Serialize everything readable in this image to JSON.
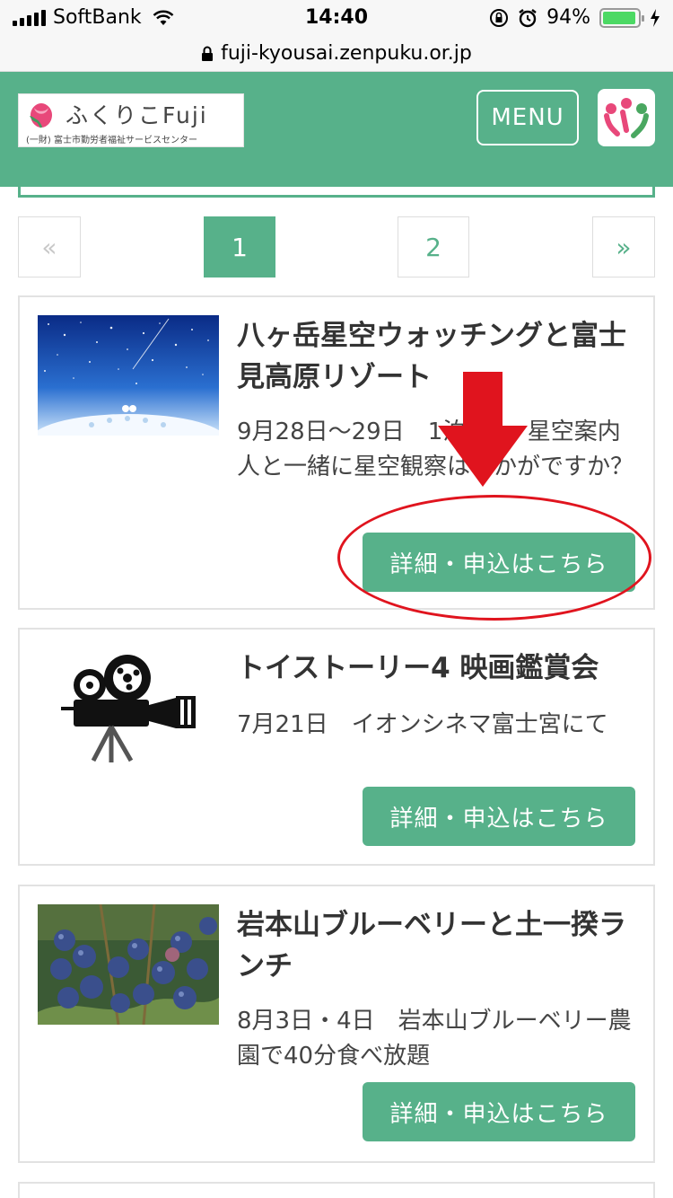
{
  "status_bar": {
    "carrier": "SoftBank",
    "time": "14:40",
    "battery": "94%",
    "battery_level": 0.94
  },
  "browser": {
    "url": "fuji-kyousai.zenpuku.or.jp"
  },
  "header": {
    "logo_title": "ふくりこFuji",
    "logo_subtitle": "(一財) 富士市勤労者福祉サービスセンター",
    "menu_label": "MENU"
  },
  "pagination": {
    "prev": "«",
    "pages": [
      "1",
      "2"
    ],
    "next": "»",
    "current": 1
  },
  "events": [
    {
      "title": "八ヶ岳星空ウォッチングと富士見高原リゾート",
      "description": "9月28日〜29日　1泊2日　星空案内人と一緒に星空観察はいかがですか？",
      "button": "詳細・申込はこちら"
    },
    {
      "title": "トイストーリー4 映画鑑賞会",
      "description": "7月21日　イオンシネマ富士宮にて",
      "button": "詳細・申込はこちら"
    },
    {
      "title": "岩本山ブルーベリーと土一揆ランチ",
      "description": "8月3日・4日　岩本山ブルーベリー農園で40分食べ放題",
      "button": "詳細・申込はこちら"
    }
  ],
  "colors": {
    "brand": "#57b18a",
    "annotation": "#e0141e"
  },
  "icons": [
    "signal-icon",
    "wifi-icon",
    "lock-icon",
    "alarm-icon",
    "orientation-lock-icon",
    "charging-icon"
  ]
}
